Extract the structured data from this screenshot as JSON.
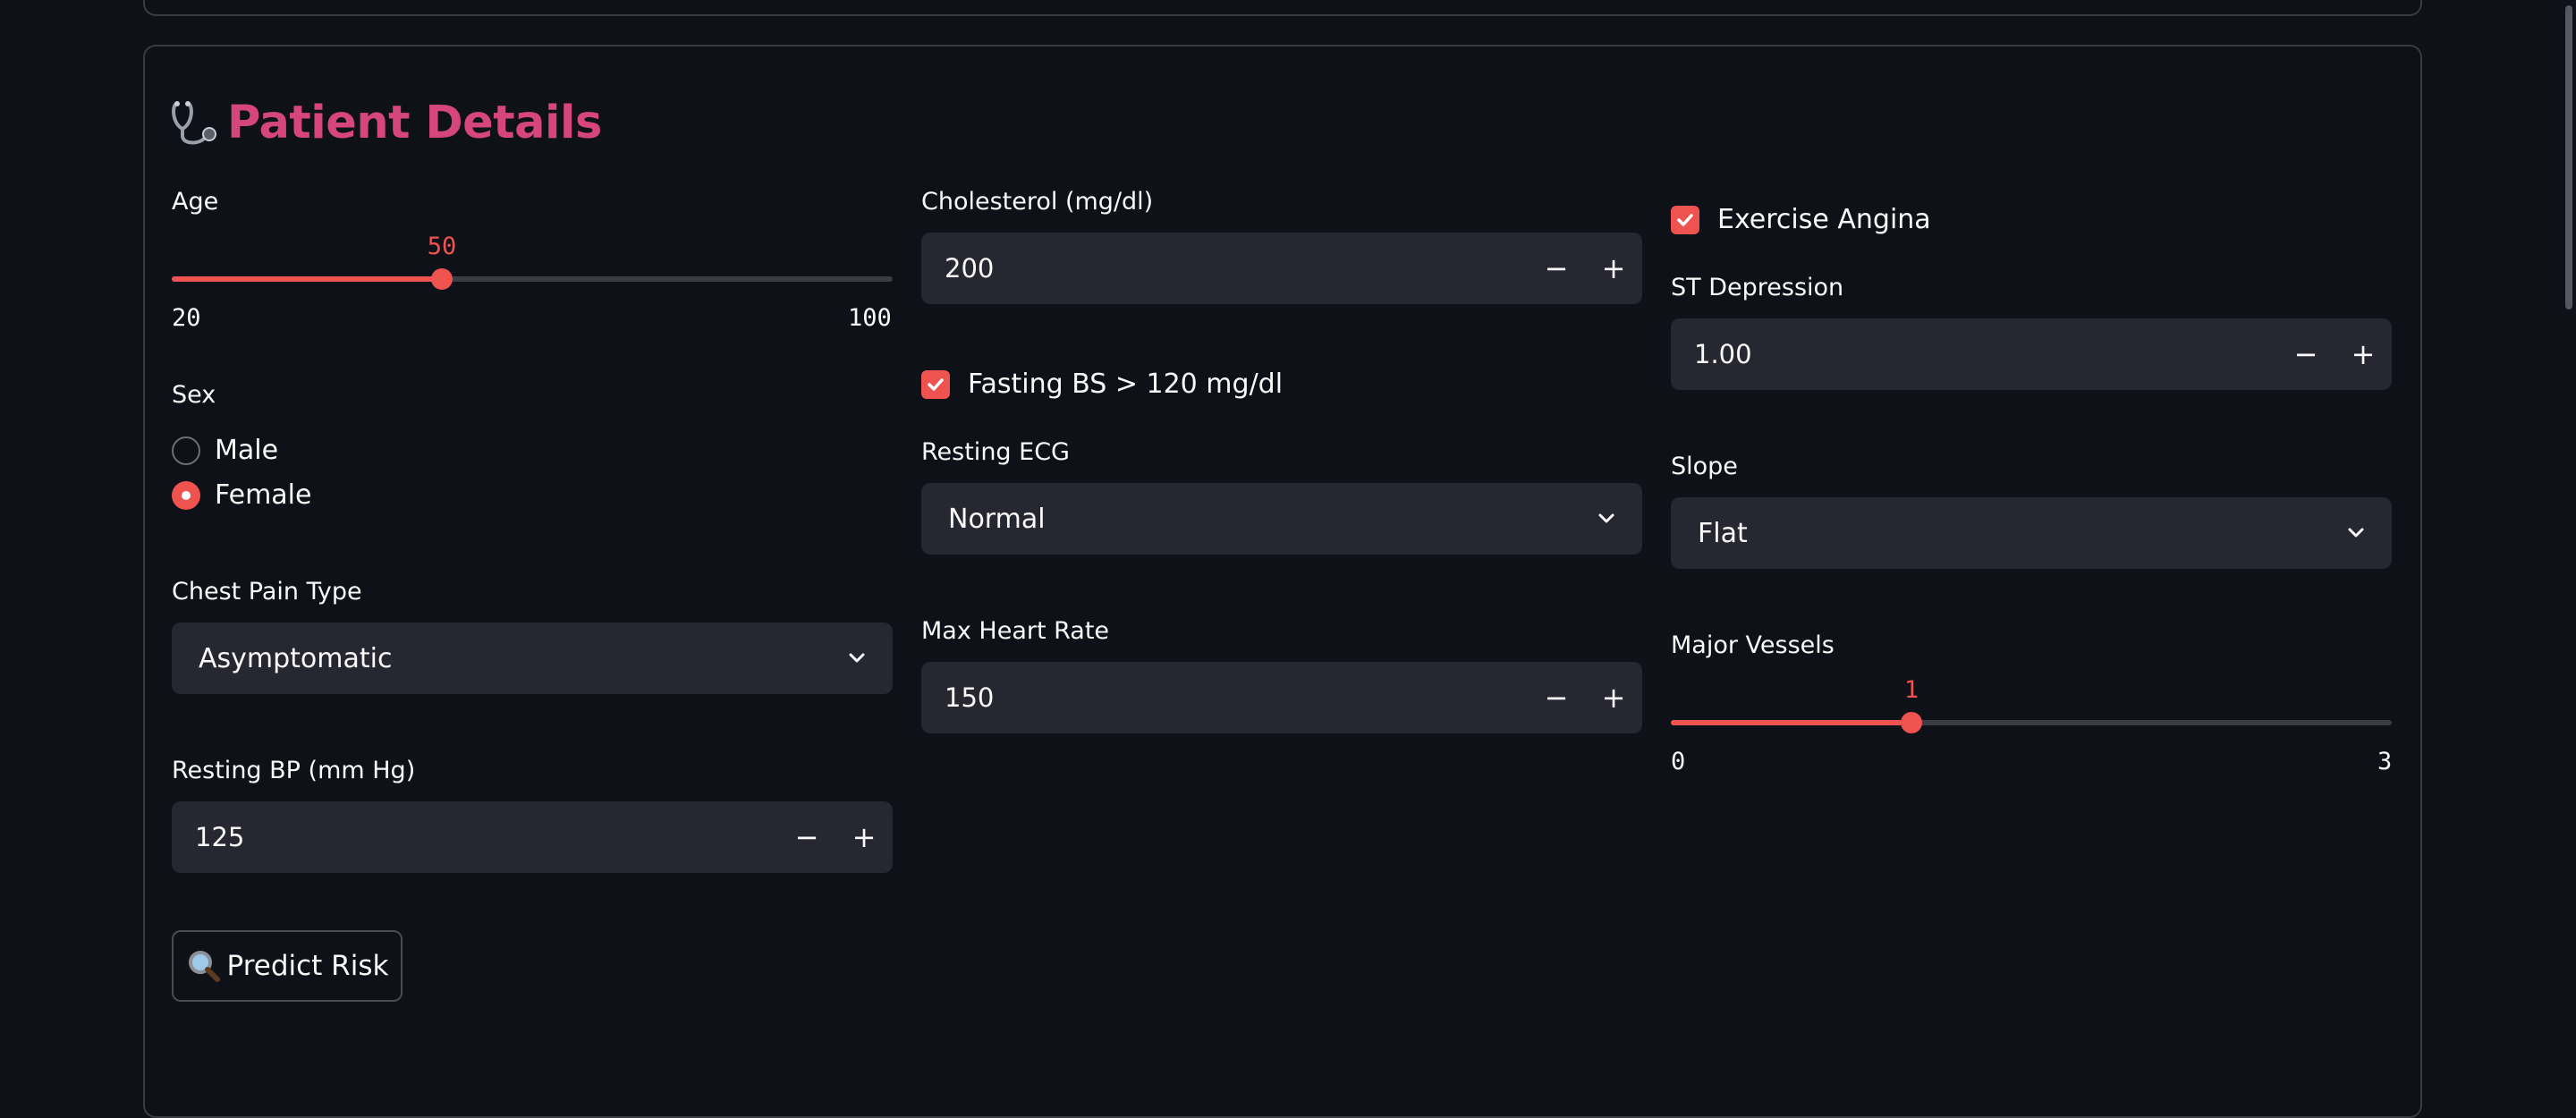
{
  "section": {
    "title": "Patient Details",
    "title_icon": "stethoscope-icon"
  },
  "age": {
    "label": "Age",
    "value": "50",
    "min": "20",
    "max": "100",
    "fraction": 0.375
  },
  "sex": {
    "label": "Sex",
    "options": [
      "Male",
      "Female"
    ],
    "selected": "Female"
  },
  "chest_pain": {
    "label": "Chest Pain Type",
    "value": "Asymptomatic"
  },
  "resting_bp": {
    "label": "Resting BP (mm Hg)",
    "value": "125"
  },
  "cholesterol": {
    "label": "Cholesterol (mg/dl)",
    "value": "200"
  },
  "fasting_bs": {
    "label": "Fasting BS > 120 mg/dl",
    "checked": true
  },
  "resting_ecg": {
    "label": "Resting ECG",
    "value": "Normal"
  },
  "max_hr": {
    "label": "Max Heart Rate",
    "value": "150"
  },
  "exercise_angina": {
    "label": "Exercise Angina",
    "checked": true
  },
  "st_depression": {
    "label": "ST Depression",
    "value": "1.00"
  },
  "slope": {
    "label": "Slope",
    "value": "Flat"
  },
  "major_vessels": {
    "label": "Major Vessels",
    "value": "1",
    "min": "0",
    "max": "3",
    "fraction": 0.3333
  },
  "stepper": {
    "minus": "−",
    "plus": "+"
  },
  "predict_button": {
    "label": "Predict Risk",
    "icon": "magnifier-icon"
  },
  "colors": {
    "accent": "#ef5350",
    "title": "#d6467e",
    "background": "#0e1117",
    "input": "#262730"
  }
}
